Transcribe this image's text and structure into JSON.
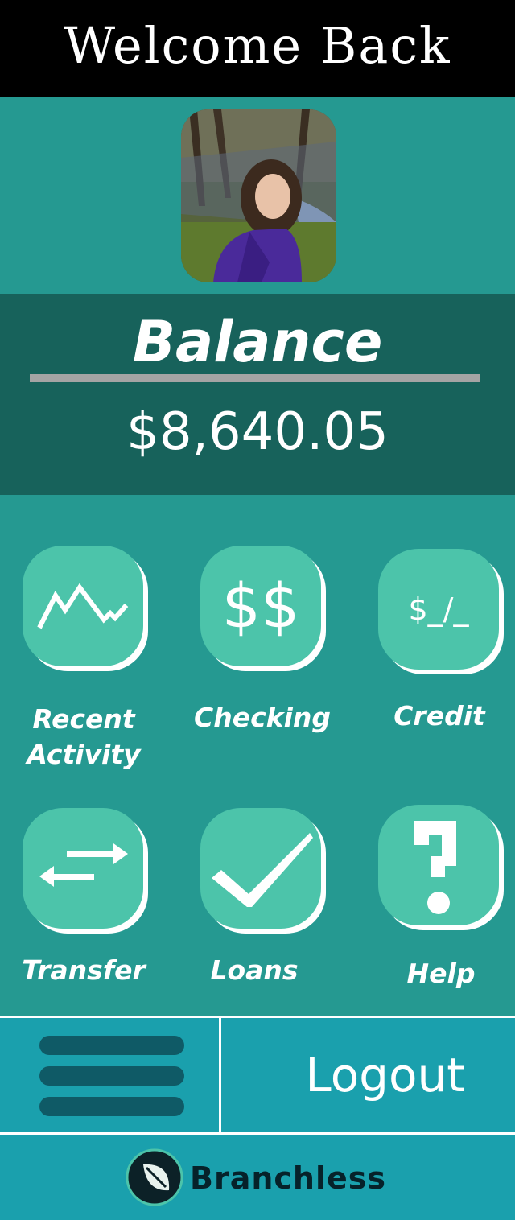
{
  "header": {
    "title": "Welcome Back"
  },
  "balance": {
    "label": "Balance",
    "amount": "$8,640.05"
  },
  "tiles": [
    {
      "label_line1": "Recent",
      "label_line2": "Activity",
      "icon": "activity-chart-icon"
    },
    {
      "label": "Checking",
      "icon": "double-dollar-icon",
      "glyph": "$$"
    },
    {
      "label": "Credit",
      "icon": "credit-icon",
      "glyph": "$_/_"
    },
    {
      "label": "Transfer",
      "icon": "transfer-arrows-icon"
    },
    {
      "label": "Loans",
      "icon": "checkmark-icon"
    },
    {
      "label": "Help",
      "icon": "question-mark-icon",
      "glyph": "?"
    }
  ],
  "footer": {
    "menu_icon": "hamburger-icon",
    "logout_label": "Logout"
  },
  "brand": {
    "name": "Branchless",
    "logo_icon": "leaf-logo-icon"
  },
  "colors": {
    "header_bg": "#000000",
    "page_bg": "#259991",
    "balance_bg": "#17625b",
    "tile_bg": "#4cc4aa",
    "footer_bg": "#1aa0ad",
    "menu_bar": "#0f5a66"
  }
}
